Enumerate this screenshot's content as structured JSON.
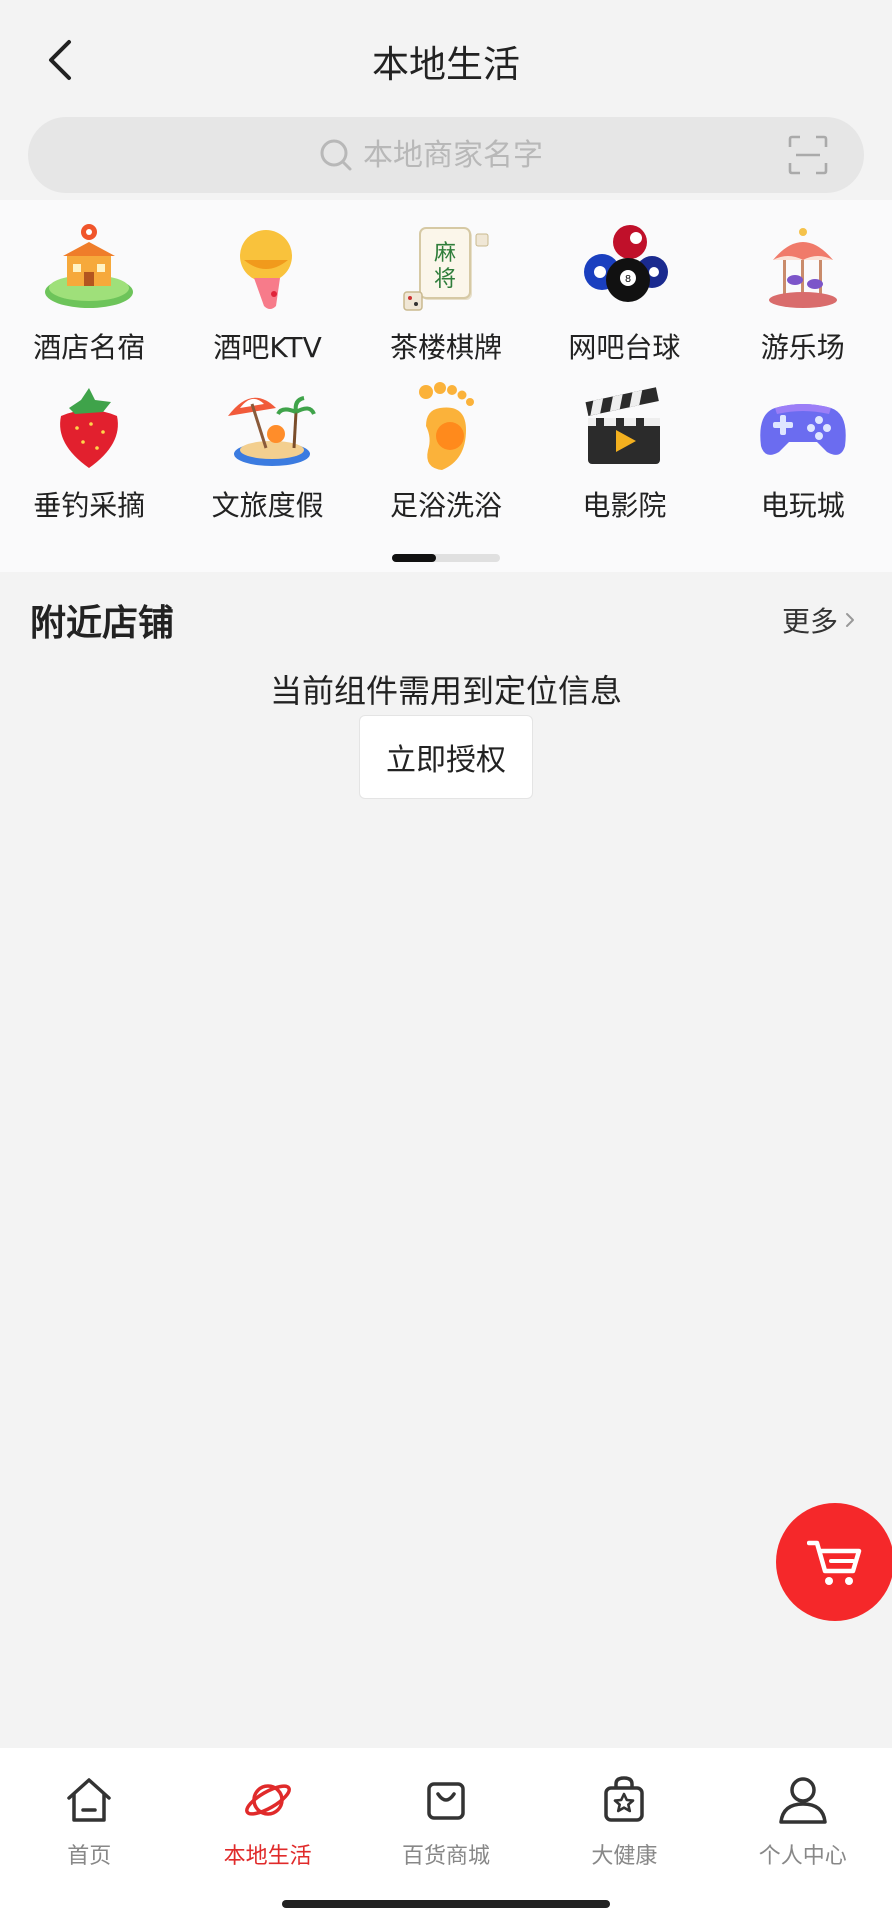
{
  "header": {
    "title": "本地生活",
    "back_icon": "chevron-left-icon"
  },
  "search": {
    "placeholder": "本地商家名字",
    "search_icon": "search-icon",
    "scan_icon": "scan-icon"
  },
  "categories": [
    {
      "label": "酒店名宿",
      "icon": "hotel-icon"
    },
    {
      "label": "酒吧KTV",
      "icon": "microphone-icon"
    },
    {
      "label": "茶楼棋牌",
      "icon": "mahjong-icon"
    },
    {
      "label": "网吧台球",
      "icon": "billiards-icon"
    },
    {
      "label": "游乐场",
      "icon": "carousel-icon"
    },
    {
      "label": "垂钓采摘",
      "icon": "strawberry-icon"
    },
    {
      "label": "文旅度假",
      "icon": "beach-umbrella-icon"
    },
    {
      "label": "足浴洗浴",
      "icon": "footprint-icon"
    },
    {
      "label": "电影院",
      "icon": "clapperboard-icon"
    },
    {
      "label": "电玩城",
      "icon": "gamepad-icon"
    }
  ],
  "nearby": {
    "title": "附近店铺",
    "more_label": "更多",
    "location_message": "当前组件需用到定位信息",
    "authorize_button": "立即授权"
  },
  "cart_fab": {
    "icon": "cart-icon"
  },
  "tabbar": {
    "active_index": 1,
    "active_color": "#e02a2a",
    "items": [
      {
        "label": "首页",
        "icon": "home-icon"
      },
      {
        "label": "本地生活",
        "icon": "planet-icon"
      },
      {
        "label": "百货商城",
        "icon": "shopping-bag-icon"
      },
      {
        "label": "大健康",
        "icon": "star-bag-icon"
      },
      {
        "label": "个人中心",
        "icon": "user-icon"
      }
    ]
  },
  "colors": {
    "accent": "#f5282a",
    "background": "#f3f3f3"
  }
}
